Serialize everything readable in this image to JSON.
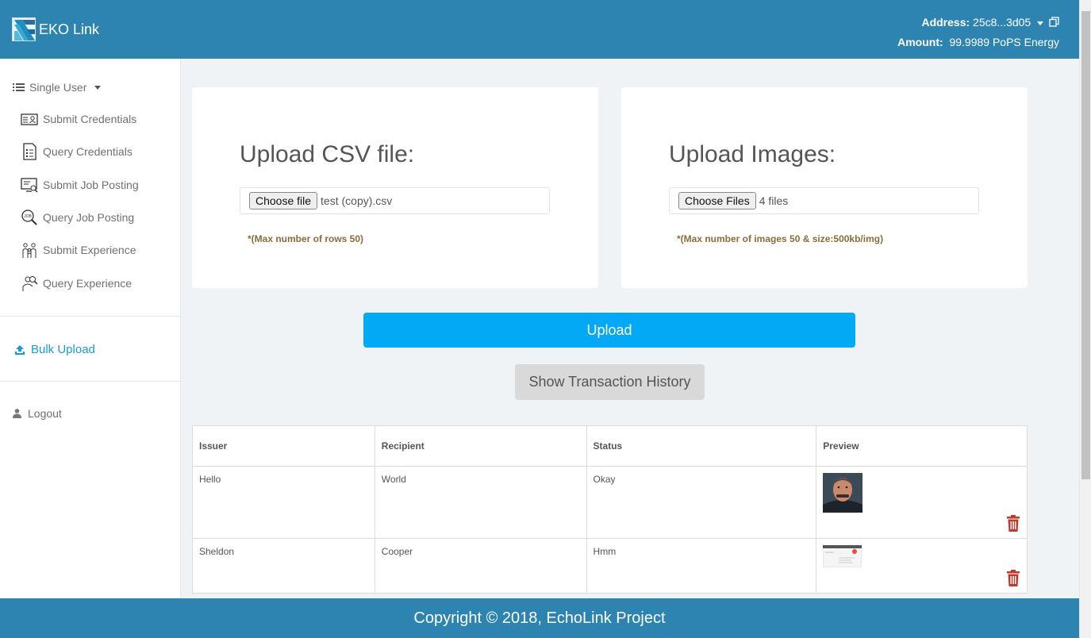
{
  "header": {
    "brand": "EKO Link",
    "address_label": "Address:",
    "address_value": "25c8...3d05",
    "amount_label": "Amount:",
    "amount_value": "99.9989 PoPS Energy"
  },
  "sidebar": {
    "group_label": "Single User",
    "items": [
      {
        "label": "Submit Credentials",
        "icon": "id-card-icon"
      },
      {
        "label": "Query Credentials",
        "icon": "document-list-icon"
      },
      {
        "label": "Submit Job Posting",
        "icon": "monitor-icon"
      },
      {
        "label": "Query Job Posting",
        "icon": "job-search-icon"
      },
      {
        "label": "Submit Experience",
        "icon": "people-icon"
      },
      {
        "label": "Query Experience",
        "icon": "person-search-icon"
      }
    ],
    "bulk_upload": "Bulk Upload",
    "logout": "Logout"
  },
  "csv_card": {
    "title": "Upload CSV file:",
    "button": "Choose file",
    "file_name": "test (copy).csv",
    "note": "*(Max number of rows 50)"
  },
  "images_card": {
    "title": "Upload Images:",
    "button": "Choose Files",
    "file_name": "4 files",
    "note": "*(Max number of images 50 & size:500kb/img)"
  },
  "upload_button": "Upload",
  "history_button": "Show Transaction History",
  "table": {
    "headers": [
      "Issuer",
      "Recipient",
      "Status",
      "Preview"
    ],
    "rows": [
      {
        "issuer": "Hello",
        "recipient": "World",
        "status": "Okay"
      },
      {
        "issuer": "Sheldon",
        "recipient": "Cooper",
        "status": "Hmm"
      }
    ]
  },
  "footer": "Copyright © 2018, EchoLink Project",
  "colors": {
    "header": "#2e84b1",
    "accent": "#03a9f4",
    "link": "#1b9ad6",
    "note": "#8a6d3b",
    "trash": "#c0392b"
  }
}
